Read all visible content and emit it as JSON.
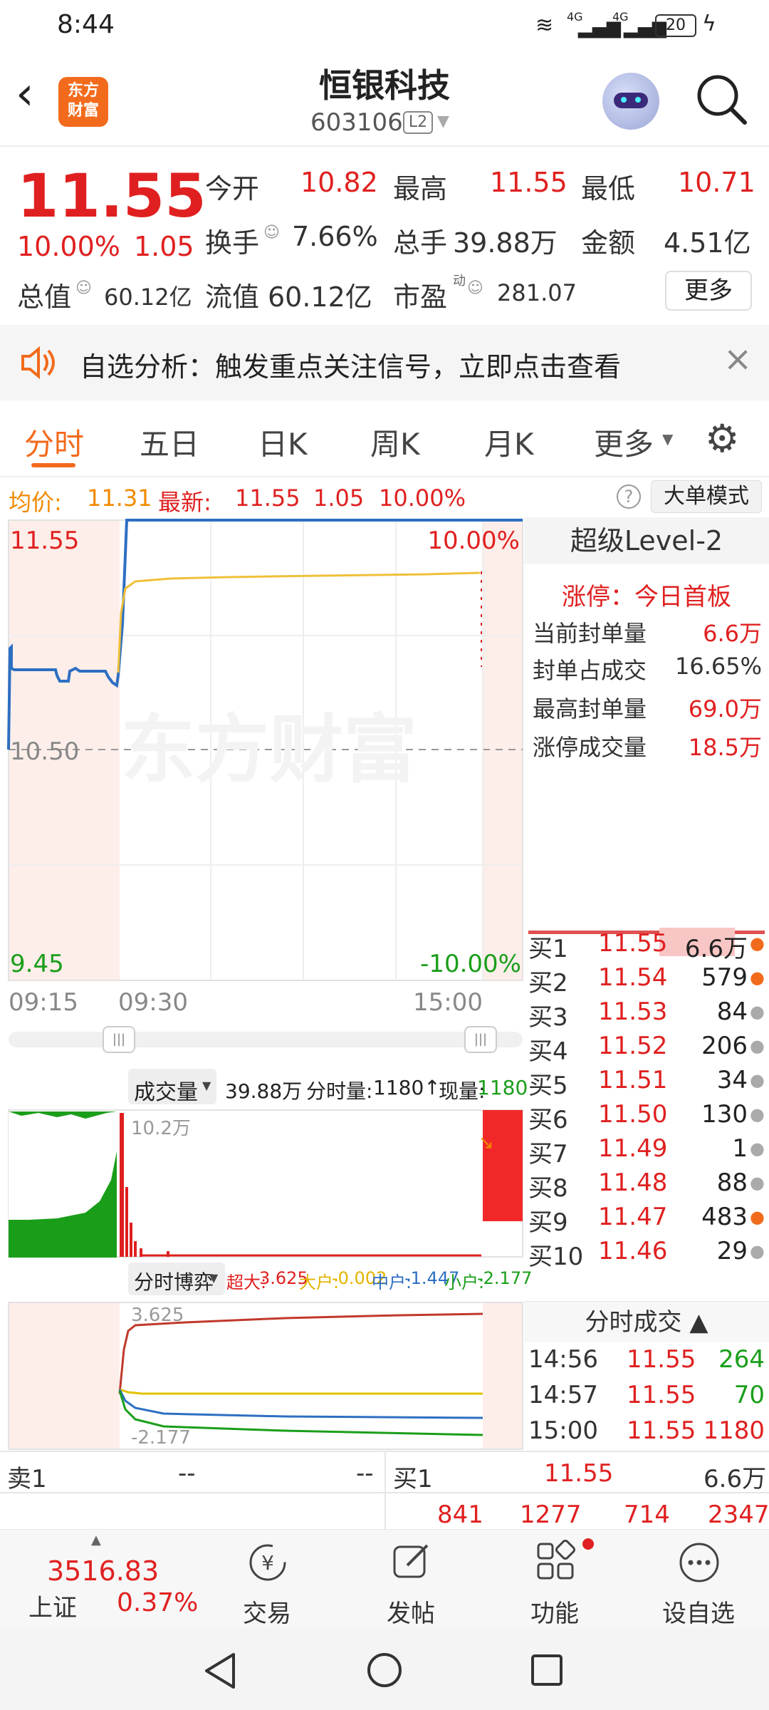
{
  "status": {
    "time": "8:44",
    "network1": "4G",
    "network2": "4G",
    "battery": "20"
  },
  "header": {
    "logo": "东方\n财富",
    "title": "恒银科技",
    "code": "603106",
    "level_badge": "L2"
  },
  "quote": {
    "price": "11.55",
    "change_pct": "10.00%",
    "change": "1.05",
    "open_label": "今开",
    "open": "10.82",
    "high_label": "最高",
    "high": "11.55",
    "low_label": "最低",
    "low": "10.71",
    "turnover_label": "换手",
    "turnover": "7.66%",
    "volume_label": "总手",
    "volume": "39.88万",
    "amount_label": "金额",
    "amount": "4.51亿",
    "mcap_label": "总值",
    "mcap": "60.12亿",
    "float_label": "流值",
    "float": "60.12亿",
    "pe_label": "市盈",
    "pe_sup": "动",
    "pe": "281.07",
    "more_btn": "更多"
  },
  "notice": {
    "text": "自选分析：触发重点关注信号，立即点击查看"
  },
  "tabs": [
    "分时",
    "五日",
    "日K",
    "周K",
    "月K",
    "更多"
  ],
  "infobar": {
    "avg_label": "均价:",
    "avg": "11.31",
    "latest_label": "最新:",
    "latest": "11.55",
    "chg": "1.05",
    "pct": "10.00%",
    "mode_btn": "大单模式"
  },
  "chart": {
    "y_top": "11.55",
    "y_mid": "10.50",
    "y_bot": "9.45",
    "pct_top": "10.00%",
    "pct_bot": "-10.00%",
    "t_start": "09:15",
    "t_open": "09:30",
    "t_end": "15:00",
    "watermark": "东方财富"
  },
  "volume": {
    "select": "成交量",
    "total": "39.88万",
    "fenshi_label": "分时量:",
    "fenshi": "1180↑",
    "now_label": "现量:",
    "now": "1180",
    "ymax": "10.2万"
  },
  "game": {
    "select": "分时博弈",
    "super_label": "超大:",
    "super": "3.625",
    "big_label": "大户:",
    "big": "-0.002",
    "mid_label": "中户:",
    "mid": "-1.447",
    "small_label": "小户:",
    "small": "-2.177",
    "ytop": "3.625",
    "ybot": "-2.177"
  },
  "level2": {
    "title": "超级Level-2",
    "limit": "涨停：今日首板",
    "rows": [
      {
        "label": "当前封单量",
        "value": "6.6万"
      },
      {
        "label": "封单占成交",
        "value": "16.65%"
      },
      {
        "label": "最高封单量",
        "value": "69.0万"
      },
      {
        "label": "涨停成交量",
        "value": "18.5万"
      }
    ]
  },
  "orderbook": [
    {
      "name": "买1",
      "price": "11.55",
      "vol": "6.6万"
    },
    {
      "name": "买2",
      "price": "11.54",
      "vol": "579"
    },
    {
      "name": "买3",
      "price": "11.53",
      "vol": "84"
    },
    {
      "name": "买4",
      "price": "11.52",
      "vol": "206"
    },
    {
      "name": "买5",
      "price": "11.51",
      "vol": "34"
    },
    {
      "name": "买6",
      "price": "11.50",
      "vol": "130"
    },
    {
      "name": "买7",
      "price": "11.49",
      "vol": "1"
    },
    {
      "name": "买8",
      "price": "11.48",
      "vol": "88"
    },
    {
      "name": "买9",
      "price": "11.47",
      "vol": "483"
    },
    {
      "name": "买10",
      "price": "11.46",
      "vol": "29"
    }
  ],
  "trades": {
    "title": "分时成交",
    "rows": [
      {
        "time": "14:56",
        "price": "11.55",
        "vol": "264"
      },
      {
        "time": "14:57",
        "price": "11.55",
        "vol": "70"
      },
      {
        "time": "15:00",
        "price": "11.55",
        "vol": "1180"
      }
    ]
  },
  "bottom_quote": {
    "sell_label": "卖1",
    "sell_price": "--",
    "sell_vol": "--",
    "buy_label": "买1",
    "buy_price": "11.55",
    "buy_vol": "6.6万",
    "n1": "841",
    "n2": "1277",
    "n3": "714",
    "n4": "2347"
  },
  "index": {
    "value": "3516.83",
    "name": "上证",
    "pct": "0.37%"
  },
  "nav": [
    "交易",
    "发帖",
    "功能",
    "设自选"
  ]
}
